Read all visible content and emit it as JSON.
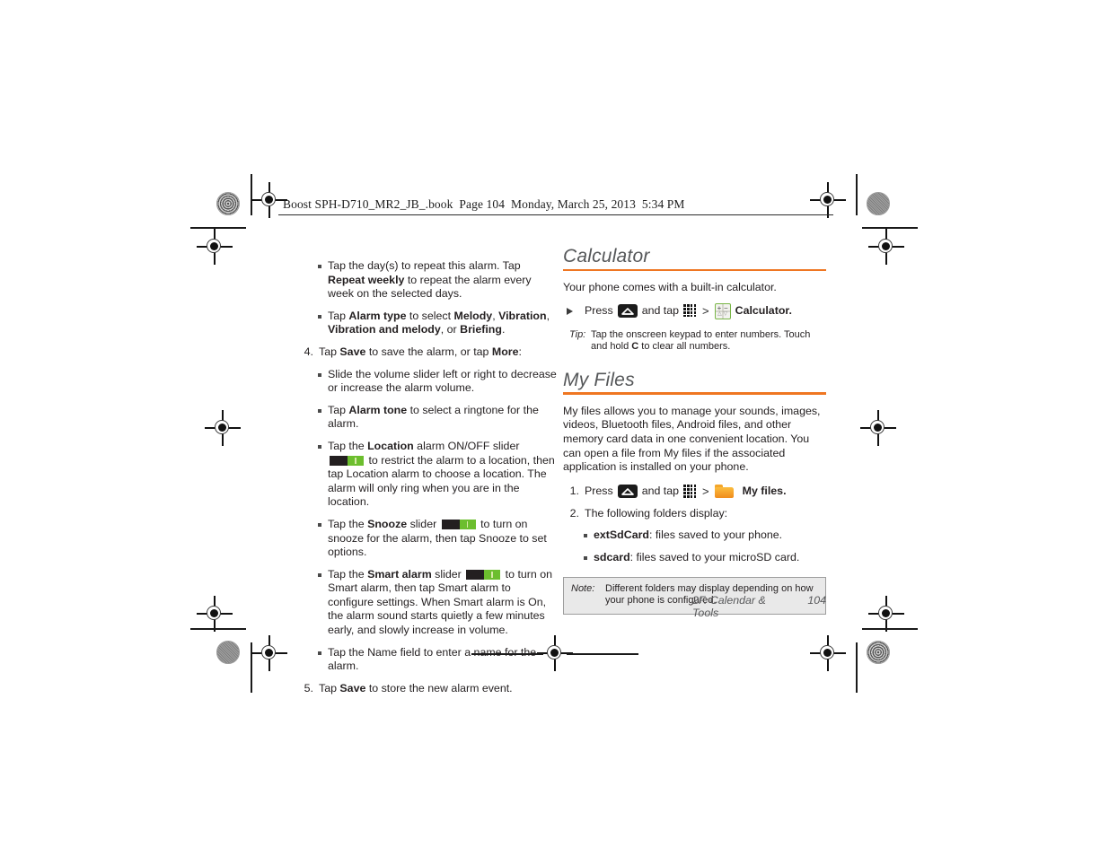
{
  "running_head": "Boost SPH-D710_MR2_JB_.book  Page 104  Monday, March 25, 2013  5:34 PM",
  "left_column": {
    "bullets_top": [
      {
        "parts": [
          {
            "t": "Tap the day(s) to repeat this alarm. Tap "
          },
          {
            "t": "Repeat weekly",
            "b": true
          },
          {
            "t": " to repeat the alarm every week on the selected days."
          }
        ]
      },
      {
        "parts": [
          {
            "t": "Tap "
          },
          {
            "t": "Alarm type",
            "b": true
          },
          {
            "t": " to select "
          },
          {
            "t": "Melody",
            "b": true
          },
          {
            "t": ", "
          },
          {
            "t": "Vibration",
            "b": true
          },
          {
            "t": ", "
          },
          {
            "t": "Vibration and melody",
            "b": true
          },
          {
            "t": ", or "
          },
          {
            "t": "Briefing",
            "b": true
          },
          {
            "t": "."
          }
        ]
      }
    ],
    "step4": {
      "num": "4.",
      "parts": [
        {
          "t": "Tap "
        },
        {
          "t": "Save",
          "b": true
        },
        {
          "t": " to save the alarm, or tap "
        },
        {
          "t": "More",
          "b": true
        },
        {
          "t": ":"
        }
      ]
    },
    "step4_bullets": [
      {
        "parts": [
          {
            "t": "Slide the volume slider left or right to decrease or increase the alarm volume."
          }
        ]
      },
      {
        "parts": [
          {
            "t": "Tap "
          },
          {
            "t": "Alarm tone",
            "b": true
          },
          {
            "t": " to select a ringtone for the alarm."
          }
        ]
      },
      {
        "parts": [
          {
            "t": "Tap the "
          },
          {
            "t": "Location",
            "b": true
          },
          {
            "t": " alarm ON/OFF slider "
          },
          {
            "icon": "onoff-slider"
          },
          {
            "t": " to restrict the alarm to a location, then tap Location alarm to choose a location. The alarm will only ring when you are in the location."
          }
        ]
      },
      {
        "parts": [
          {
            "t": "Tap the "
          },
          {
            "t": "Snooze",
            "b": true
          },
          {
            "t": " slider "
          },
          {
            "icon": "onoff-slider"
          },
          {
            "t": " to turn on snooze for the alarm, then tap Snooze to set options."
          }
        ]
      },
      {
        "parts": [
          {
            "t": "Tap the "
          },
          {
            "t": "Smart alarm",
            "b": true
          },
          {
            "t": " slider "
          },
          {
            "icon": "onoff-slider"
          },
          {
            "t": " to turn on Smart alarm, then tap Smart alarm to configure settings. When Smart alarm is On, the alarm sound starts quietly a few minutes early, and slowly increase in volume."
          }
        ]
      },
      {
        "parts": [
          {
            "t": "Tap the Name field to enter a name for the alarm."
          }
        ]
      }
    ],
    "step5": {
      "num": "5.",
      "parts": [
        {
          "t": "Tap "
        },
        {
          "t": "Save",
          "b": true
        },
        {
          "t": " to store the new alarm event."
        }
      ]
    }
  },
  "right_column": {
    "calculator": {
      "heading": "Calculator",
      "intro": "Your phone comes with a built-in calculator.",
      "step": {
        "lead": "Press",
        "mid": "and tap",
        "label": "Calculator.",
        "icons": [
          "home-icon",
          "apps-grid-icon",
          "calculator-icon"
        ],
        "separator": ">"
      },
      "tip": {
        "label": "Tip:",
        "parts": [
          {
            "t": "Tap the onscreen keypad to enter numbers. Touch and hold "
          },
          {
            "t": "C",
            "b": true
          },
          {
            "t": " to clear all numbers."
          }
        ]
      }
    },
    "my_files": {
      "heading": "My Files",
      "intro": "My files allows you to manage your sounds, images, videos, Bluetooth files, Android files, and other memory card data in one convenient location. You can open a file from My files if the associated application is installed on your phone.",
      "step1": {
        "num": "1.",
        "lead": "Press",
        "mid": "and tap",
        "label": "My files.",
        "separator": ">",
        "icons": [
          "home-icon",
          "apps-grid-icon",
          "folder-icon"
        ]
      },
      "step2": {
        "num": "2.",
        "text": "The following folders display:"
      },
      "folders": [
        {
          "parts": [
            {
              "t": "extSdCard",
              "b": true
            },
            {
              "t": ": files saved to your phone."
            }
          ]
        },
        {
          "parts": [
            {
              "t": "sdcard",
              "b": true
            },
            {
              "t": ": files saved to your microSD card."
            }
          ]
        }
      ],
      "note": {
        "label": "Note:",
        "text": "Different folders may display depending on how your phone is configured."
      }
    }
  },
  "footer": {
    "chapter": "2F. Calendar & Tools",
    "page": "104"
  },
  "colors": {
    "accent_rule": "#ef7622",
    "heading_text": "#555759",
    "slider_on": "#6cbe2e",
    "slider_off": "#231f20",
    "folder": "#f4a62a",
    "calc_border": "#7ab648",
    "note_bg": "#e9e9e9"
  }
}
